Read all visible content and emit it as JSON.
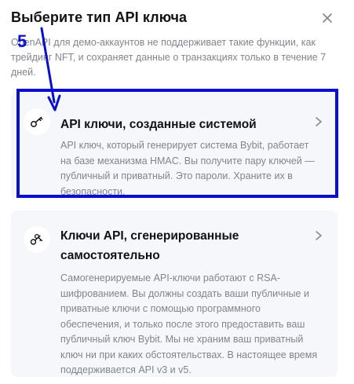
{
  "dialog": {
    "title": "Выберите тип API ключа",
    "description": "OpenAPI для демо-аккаунтов не поддерживает такие функции, как трейдинг NFT, и сохраняет данные о транзакциях только в течение 7 дней."
  },
  "options": [
    {
      "title": "API ключи, созданные системой",
      "text": "API ключ, который генерирует система Bybit, работает на базе механизма HMAC. Вы получите пару ключей — публичный и приватный. Это пароли. Храните их в безопасности.",
      "icon": "key-icon"
    },
    {
      "title": "Ключи API, сгенерированные самостоятельно",
      "text": "Самогенерируемые API-ключи работают с RSA-шифрованием. Вы должны создать ваши публичные и приватные ключи с помощью программного обеспечения, и только после этого предоставить ваш публичный ключ Bybit. Мы не храним ваш приватный ключ ни при каких обстоятельствах. В настоящее время поддерживается API v3 и v5.",
      "icon": "keys-icon"
    }
  ],
  "annotation": {
    "step_number": "5",
    "color": "#0a0fcf"
  },
  "colors": {
    "text_primary": "#121214",
    "text_secondary": "#81858c",
    "card_bg": "#f5f7fa"
  }
}
